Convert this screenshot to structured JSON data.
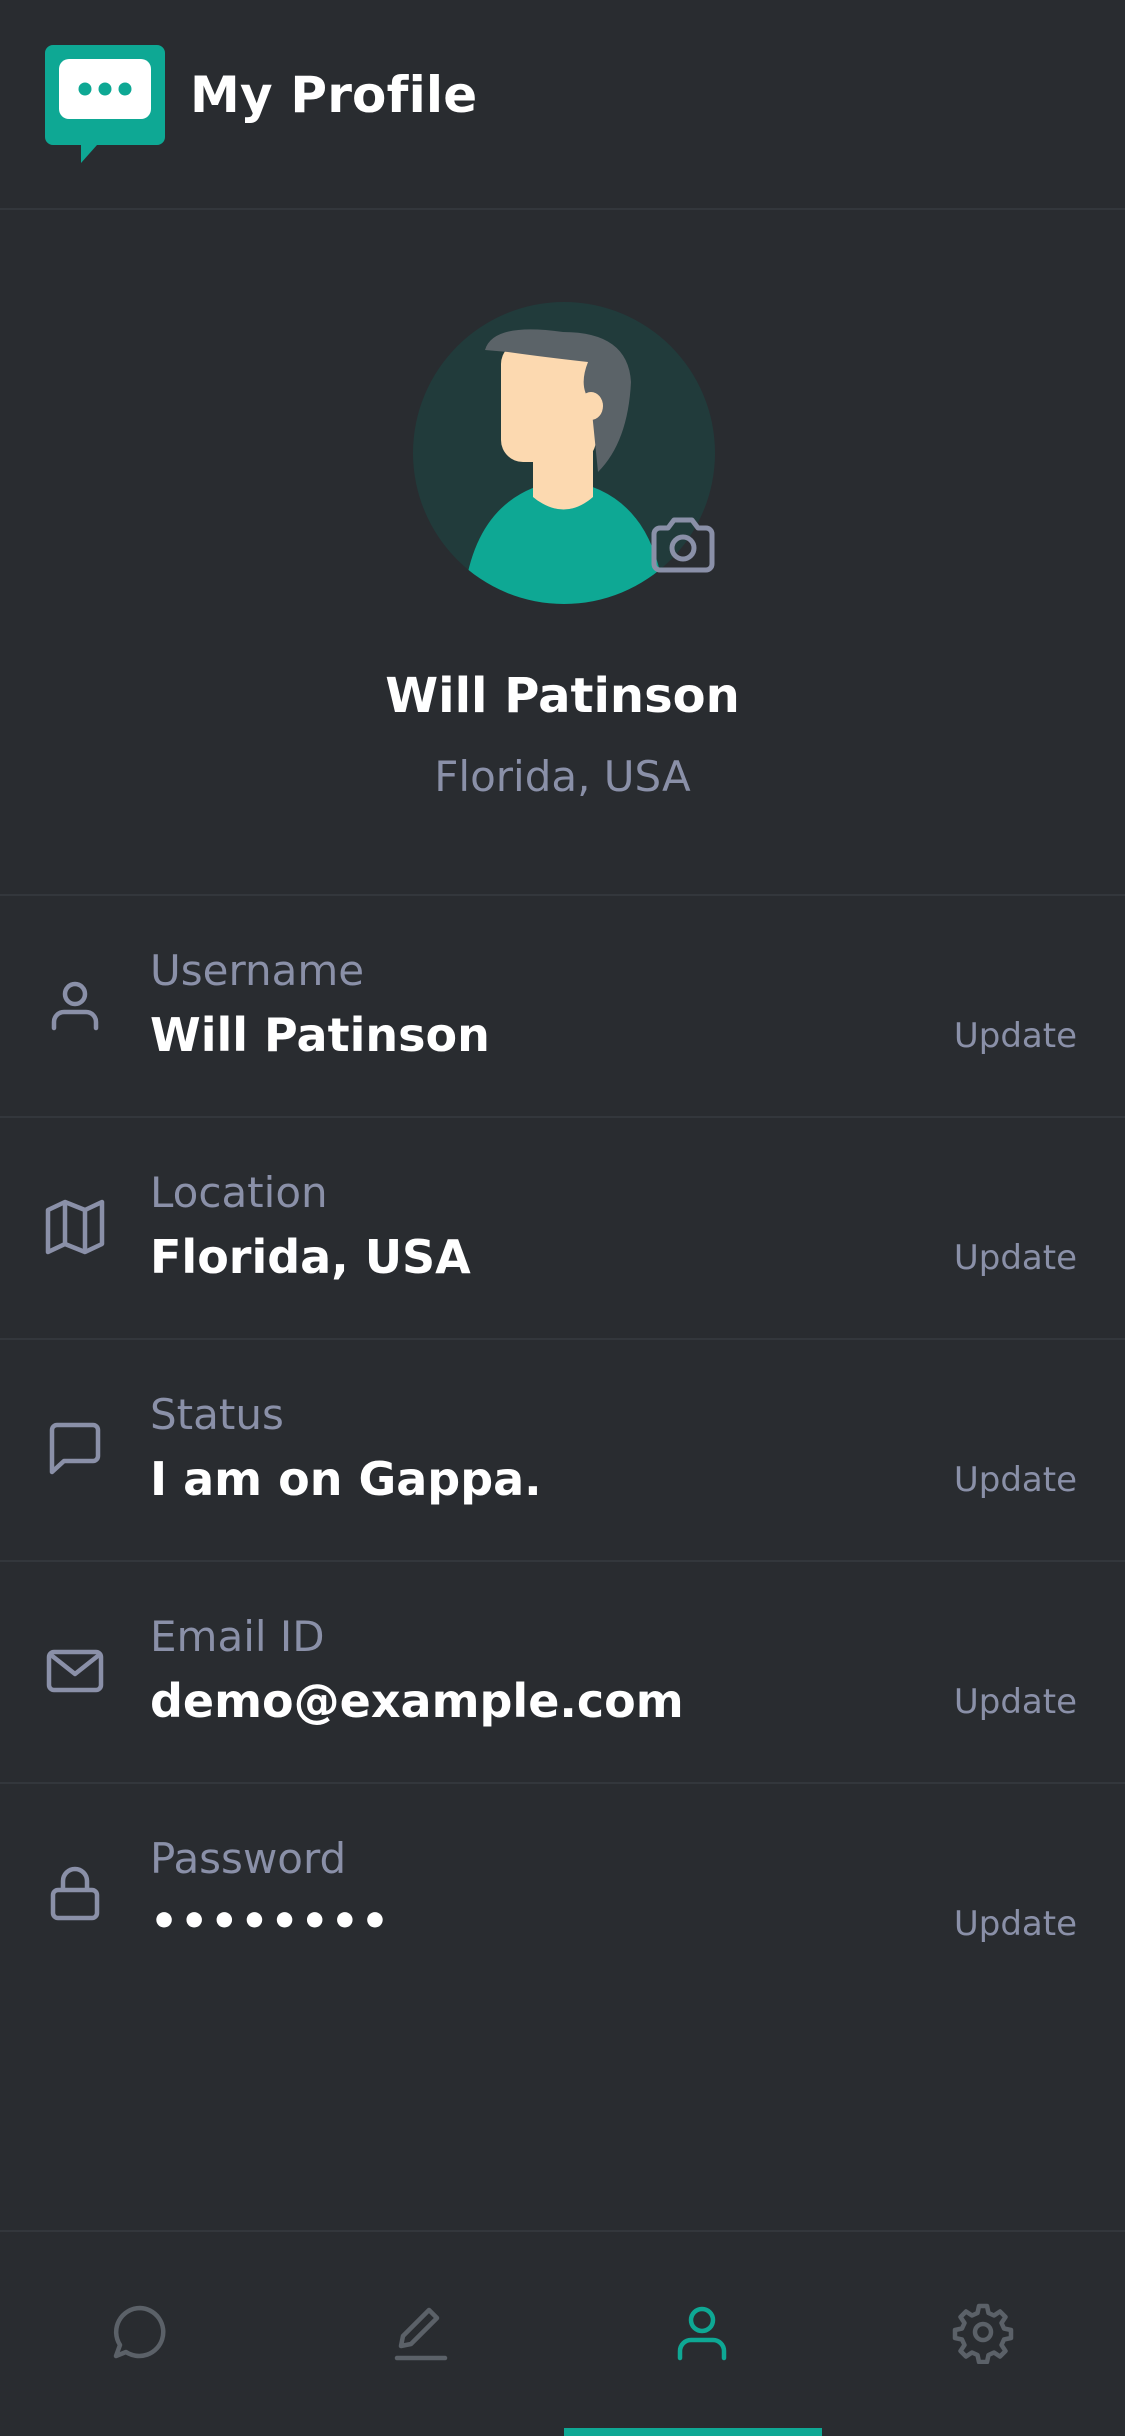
{
  "header": {
    "title": "My Profile",
    "logo_icon": "chat-bubble-logo-icon"
  },
  "colors": {
    "accent": "#0ea894",
    "background": "#292c30",
    "muted_text": "#8a90a8"
  },
  "profile": {
    "name": "Will Patinson",
    "location": "Florida, USA"
  },
  "details": [
    {
      "icon": "user-icon",
      "label": "Username",
      "value": "Will Patinson",
      "action": "Update"
    },
    {
      "icon": "map-icon",
      "label": "Location",
      "value": "Florida, USA",
      "action": "Update"
    },
    {
      "icon": "message-square-icon",
      "label": "Status",
      "value": "I am on Gappa.",
      "action": "Update"
    },
    {
      "icon": "mail-icon",
      "label": "Email ID",
      "value": "demo@example.com",
      "action": "Update"
    },
    {
      "icon": "lock-icon",
      "label": "Password",
      "value": "••••••••",
      "action": "Update"
    }
  ],
  "bottom_nav": {
    "items": [
      {
        "icon": "chat-icon",
        "active": false
      },
      {
        "icon": "edit-icon",
        "active": false
      },
      {
        "icon": "profile-icon",
        "active": true
      },
      {
        "icon": "settings-icon",
        "active": false
      }
    ]
  }
}
